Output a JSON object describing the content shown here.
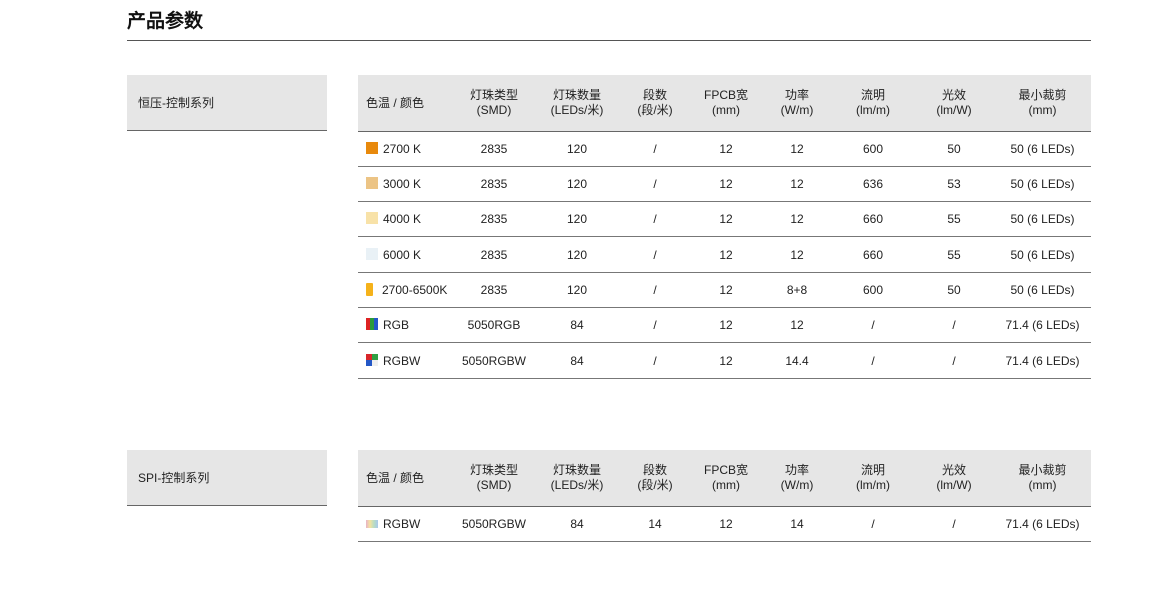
{
  "page_title": "产品参数",
  "headers": [
    {
      "l1": "色温 / 颜色",
      "l2": ""
    },
    {
      "l1": "灯珠类型",
      "l2": "(SMD)"
    },
    {
      "l1": "灯珠数量",
      "l2": "(LEDs/米)"
    },
    {
      "l1": "段数",
      "l2": "(段/米)"
    },
    {
      "l1": "FPCB宽",
      "l2": "(mm)"
    },
    {
      "l1": "功率",
      "l2": "(W/m)"
    },
    {
      "l1": "流明",
      "l2": "(lm/m)"
    },
    {
      "l1": "光效",
      "l2": "(lm/W)"
    },
    {
      "l1": "最小裁剪",
      "l2": "(mm)"
    }
  ],
  "sections": [
    {
      "label": "恒压-控制系列",
      "rows": [
        {
          "swatch": "solid",
          "color": "#e8890c",
          "cells": [
            "2700 K",
            "2835",
            "120",
            "/",
            "12",
            "12",
            "600",
            "50",
            "50 (6 LEDs)"
          ]
        },
        {
          "swatch": "solid",
          "color": "#ecc485",
          "cells": [
            "3000 K",
            "2835",
            "120",
            "/",
            "12",
            "12",
            "636",
            "53",
            "50 (6 LEDs)"
          ]
        },
        {
          "swatch": "solid",
          "color": "#f8e2a8",
          "cells": [
            "4000 K",
            "2835",
            "120",
            "/",
            "12",
            "12",
            "660",
            "55",
            "50 (6 LEDs)"
          ]
        },
        {
          "swatch": "solid",
          "color": "#e9f1f6",
          "cells": [
            "6000 K",
            "2835",
            "120",
            "/",
            "12",
            "12",
            "660",
            "55",
            "50 (6 LEDs)"
          ]
        },
        {
          "swatch": "tall",
          "color": "#f5b21a",
          "cells": [
            "2700-6500K",
            "2835",
            "120",
            "/",
            "12",
            "8+8",
            "600",
            "50",
            "50 (6 LEDs)"
          ]
        },
        {
          "swatch": "rgb",
          "color": "",
          "cells": [
            "RGB",
            "5050RGB",
            "84",
            "/",
            "12",
            "12",
            "/",
            "/",
            "71.4 (6 LEDs)"
          ]
        },
        {
          "swatch": "rgbw",
          "color": "",
          "cells": [
            "RGBW",
            "5050RGBW",
            "84",
            "/",
            "12",
            "14.4",
            "/",
            "/",
            "71.4 (6 LEDs)"
          ]
        }
      ]
    },
    {
      "label": "SPI-控制系列",
      "rows": [
        {
          "swatch": "spi",
          "color": "",
          "cells": [
            "RGBW",
            "5050RGBW",
            "84",
            "14",
            "12",
            "14",
            "/",
            "/",
            "71.4 (6 LEDs)"
          ]
        }
      ]
    }
  ]
}
